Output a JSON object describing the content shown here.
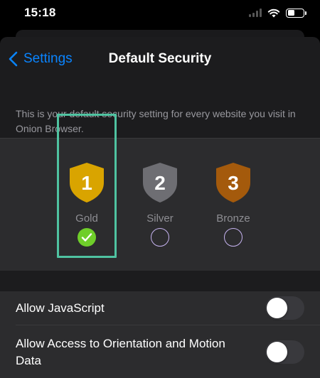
{
  "status_bar": {
    "time": "15:18",
    "icons": [
      "signal-icon",
      "wifi-icon",
      "battery-icon"
    ]
  },
  "nav": {
    "back_label": "Settings",
    "title": "Default Security"
  },
  "description": "This is your default security setting for every website you visit in Onion Browser.",
  "levels": [
    {
      "number": "1",
      "label": "Gold",
      "color": "#d9a400",
      "selected": true
    },
    {
      "number": "2",
      "label": "Silver",
      "color": "#6e6e73",
      "selected": false
    },
    {
      "number": "3",
      "label": "Bronze",
      "color": "#a45a0c",
      "selected": false
    }
  ],
  "settings": [
    {
      "label": "Allow JavaScript",
      "enabled": false
    },
    {
      "label": "Allow Access to Orientation and Motion Data",
      "enabled": false
    }
  ],
  "colors": {
    "accent": "#0a84ff",
    "selection_frame": "#4fc3a1",
    "check": "#6fce2a"
  }
}
